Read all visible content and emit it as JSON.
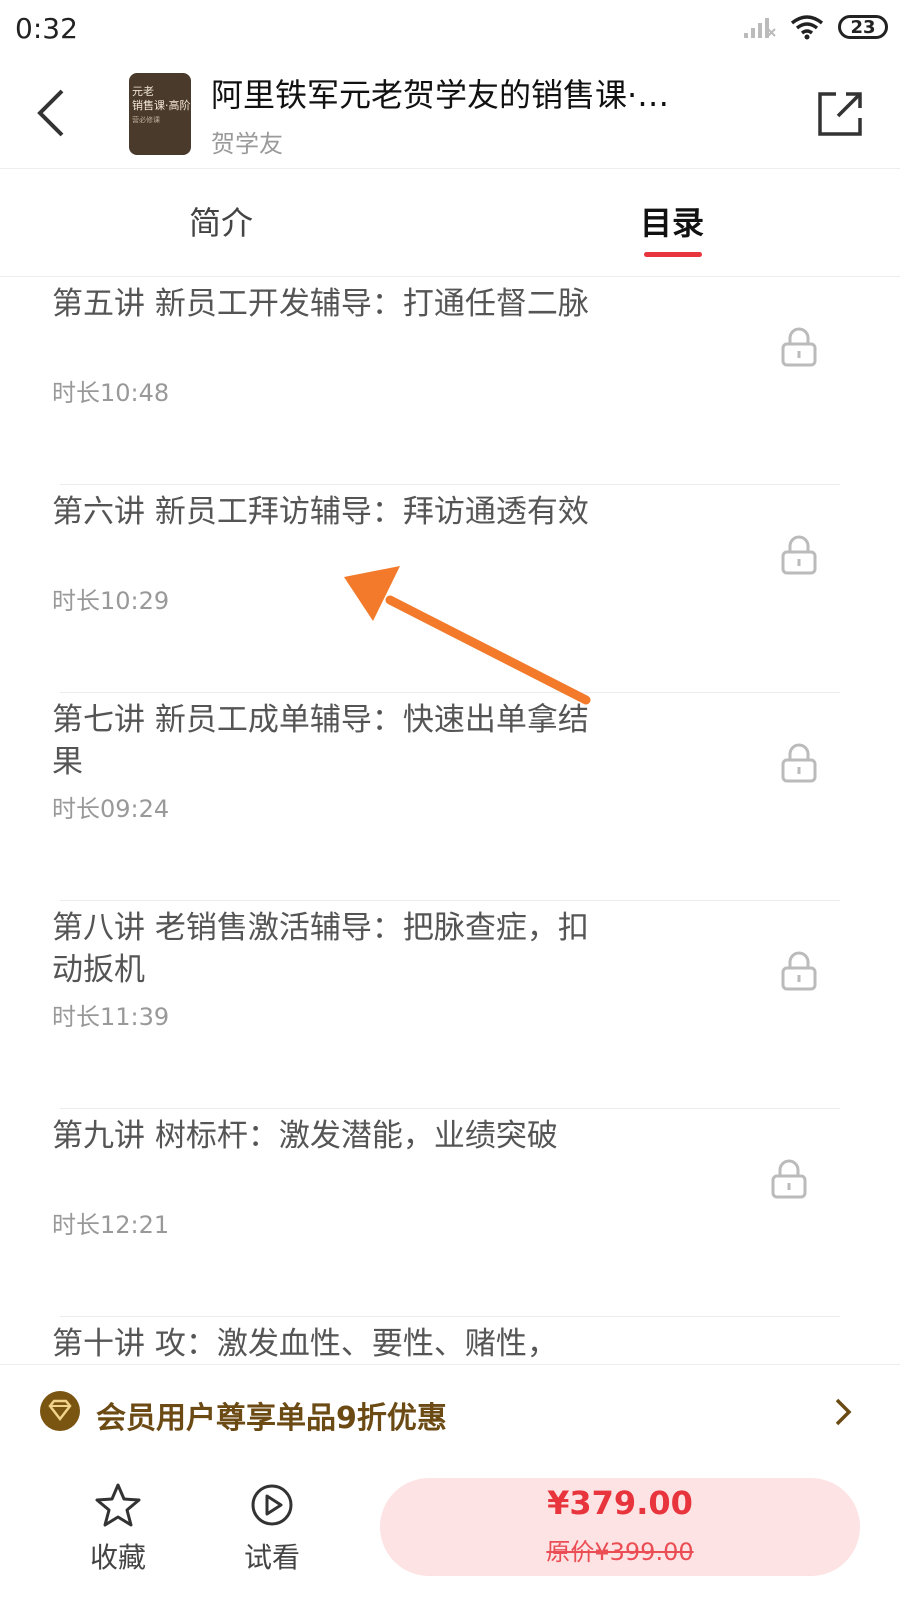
{
  "status_bar": {
    "time": "0:32",
    "battery": "23"
  },
  "header": {
    "title": "阿里铁军元老贺学友的销售课·…",
    "author": "贺学友",
    "cover": {
      "line1": "元老",
      "line2": "销售课·高阶",
      "line3": "营必修课"
    }
  },
  "tabs": [
    {
      "label": "简介",
      "active": false
    },
    {
      "label": "目录",
      "active": true
    }
  ],
  "lessons": [
    {
      "title": "第五讲 新员工开发辅导：打通任督二脉",
      "duration": "时长10:48",
      "locked": true
    },
    {
      "title": "第六讲 新员工拜访辅导：拜访通透有效",
      "duration": "时长10:29",
      "locked": true
    },
    {
      "title": "第七讲 新员工成单辅导：快速出单拿结果",
      "duration": "时长09:24",
      "locked": true
    },
    {
      "title": "第八讲 老销售激活辅导：把脉查症，扣动扳机",
      "duration": "时长11:39",
      "locked": true
    },
    {
      "title": "第九讲 树标杆：激发潜能，业绩突破",
      "duration": "时长12:21",
      "locked": true
    },
    {
      "title": "第十讲 攻：激发血性、要性、赌性，",
      "duration": "",
      "locked": true
    }
  ],
  "member_promo": {
    "text": "会员用户尊享单品9折优惠"
  },
  "bottom": {
    "favorite_label": "收藏",
    "trial_label": "试看",
    "price": "¥379.00",
    "original_price": "原价¥399.00"
  },
  "colors": {
    "accent": "#e8343c",
    "member_gold": "#6b4a14",
    "annotation_arrow": "#f27a2a"
  }
}
